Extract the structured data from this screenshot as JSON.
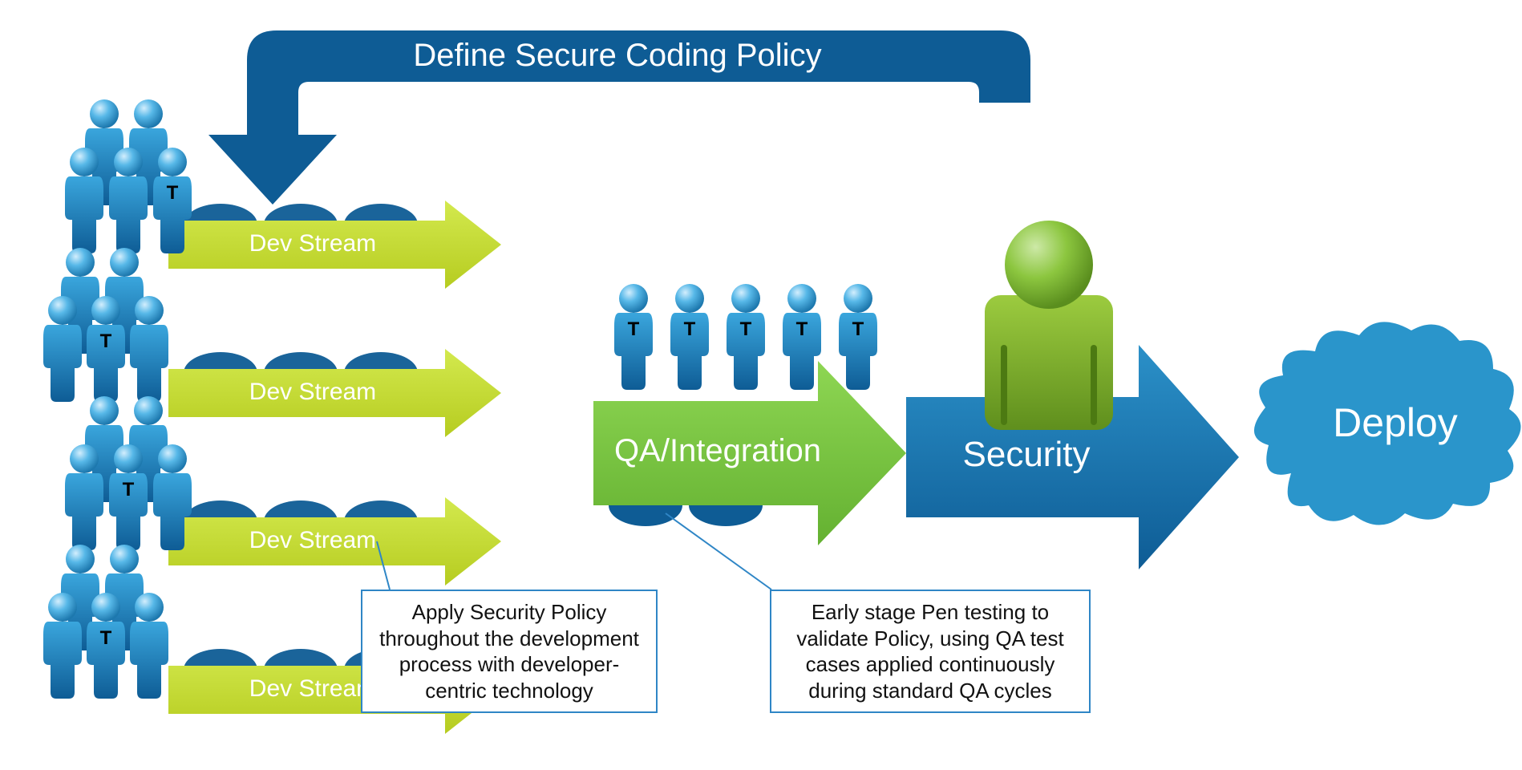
{
  "flow": {
    "feedback_label": "Define Secure Coding Policy",
    "dev_streams": [
      "Dev Stream",
      "Dev Stream",
      "Dev Stream",
      "Dev Stream"
    ],
    "qa_label": "QA/Integration",
    "security_label": "Security",
    "deploy_label": "Deploy",
    "callout_dev": "Apply Security Policy throughout the development process with developer-centric technology",
    "callout_qa": "Early stage Pen testing to validate Policy, using QA test cases applied continuously during standard QA cycles",
    "icon_t_label": "T"
  },
  "colors": {
    "blue_dark": "#0E5C95",
    "blue_mid": "#1F7EB8",
    "blue_light": "#2F99D2",
    "lime": "#C2D72E",
    "green_arrow": "#7AC943",
    "green_body": "#7FB72A",
    "green_head": "#73B72A",
    "cloud": "#2A95CB",
    "callout_border": "#2F86C6"
  }
}
